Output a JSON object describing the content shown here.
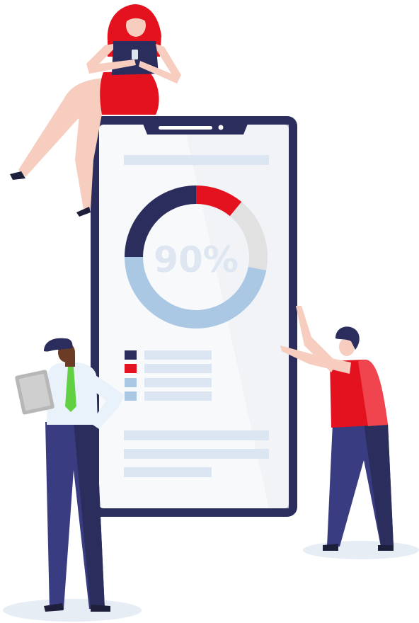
{
  "illustration": {
    "donut_label": "90%",
    "colors": {
      "navy": "#2b2d5c",
      "red": "#e3121e",
      "light_gray": "#e1e1e1",
      "light_blue": "#aac7e4",
      "pale_blue": "#dbe6f2",
      "screen": "#f8f9fb",
      "skin_light": "#f6cdbe",
      "skin_dark": "#6b3b26",
      "shirt_white": "#e9f1fa",
      "tie_green": "#62d043",
      "pants_navy": "#393c80",
      "shadow": "#e6edf5"
    },
    "legend_colors": [
      "#2b2d5c",
      "#e3121e",
      "#aac7e4",
      "#aac7e4"
    ]
  },
  "chart_data": {
    "type": "pie",
    "donut": true,
    "center_label": "90%",
    "segments": [
      {
        "color": "#e3121e",
        "value": 11
      },
      {
        "color": "#e1e1e1",
        "value": 17
      },
      {
        "color": "#aac7e4",
        "value": 47
      },
      {
        "color": "#2b2d5c",
        "value": 25
      }
    ]
  }
}
